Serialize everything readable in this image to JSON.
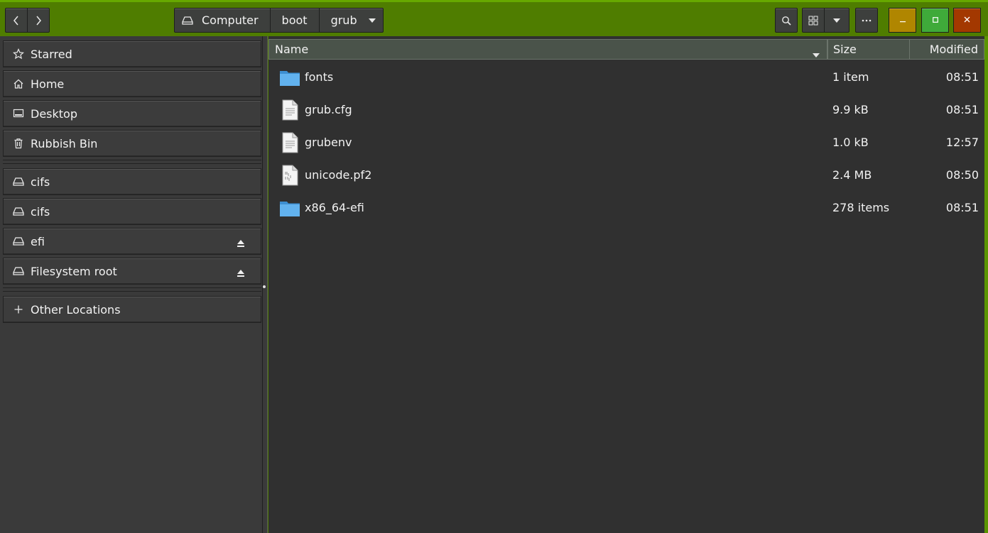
{
  "header": {
    "breadcrumbs": [
      "Computer",
      "boot",
      "grub"
    ]
  },
  "sidebar": {
    "places": [
      {
        "label": "Starred",
        "icon": "star-icon"
      },
      {
        "label": "Home",
        "icon": "home-icon"
      },
      {
        "label": "Desktop",
        "icon": "desktop-icon"
      },
      {
        "label": "Rubbish Bin",
        "icon": "trash-icon"
      }
    ],
    "devices": [
      {
        "label": "cifs",
        "icon": "drive-icon",
        "eject": false
      },
      {
        "label": "cifs",
        "icon": "drive-icon",
        "eject": false
      },
      {
        "label": "efi",
        "icon": "drive-icon",
        "eject": true
      },
      {
        "label": "Filesystem root",
        "icon": "drive-icon",
        "eject": true
      }
    ],
    "other": {
      "label": "Other Locations",
      "icon": "plus-icon"
    }
  },
  "list": {
    "columns": {
      "name": "Name",
      "size": "Size",
      "modified": "Modified"
    },
    "files": [
      {
        "name": "fonts",
        "size": "1 item",
        "modified": "08:51",
        "type": "folder"
      },
      {
        "name": "grub.cfg",
        "size": "9.9 kB",
        "modified": "08:51",
        "type": "text"
      },
      {
        "name": "grubenv",
        "size": "1.0 kB",
        "modified": "12:57",
        "type": "text"
      },
      {
        "name": "unicode.pf2",
        "size": "2.4 MB",
        "modified": "08:50",
        "type": "binary"
      },
      {
        "name": "x86_64-efi",
        "size": "278 items",
        "modified": "08:51",
        "type": "folder"
      }
    ]
  },
  "colors": {
    "titlebar": "#4f7d00",
    "minimize": "#b08600",
    "maximize": "#3faa3a",
    "close": "#a33800",
    "folder": "#4fa3e0"
  }
}
